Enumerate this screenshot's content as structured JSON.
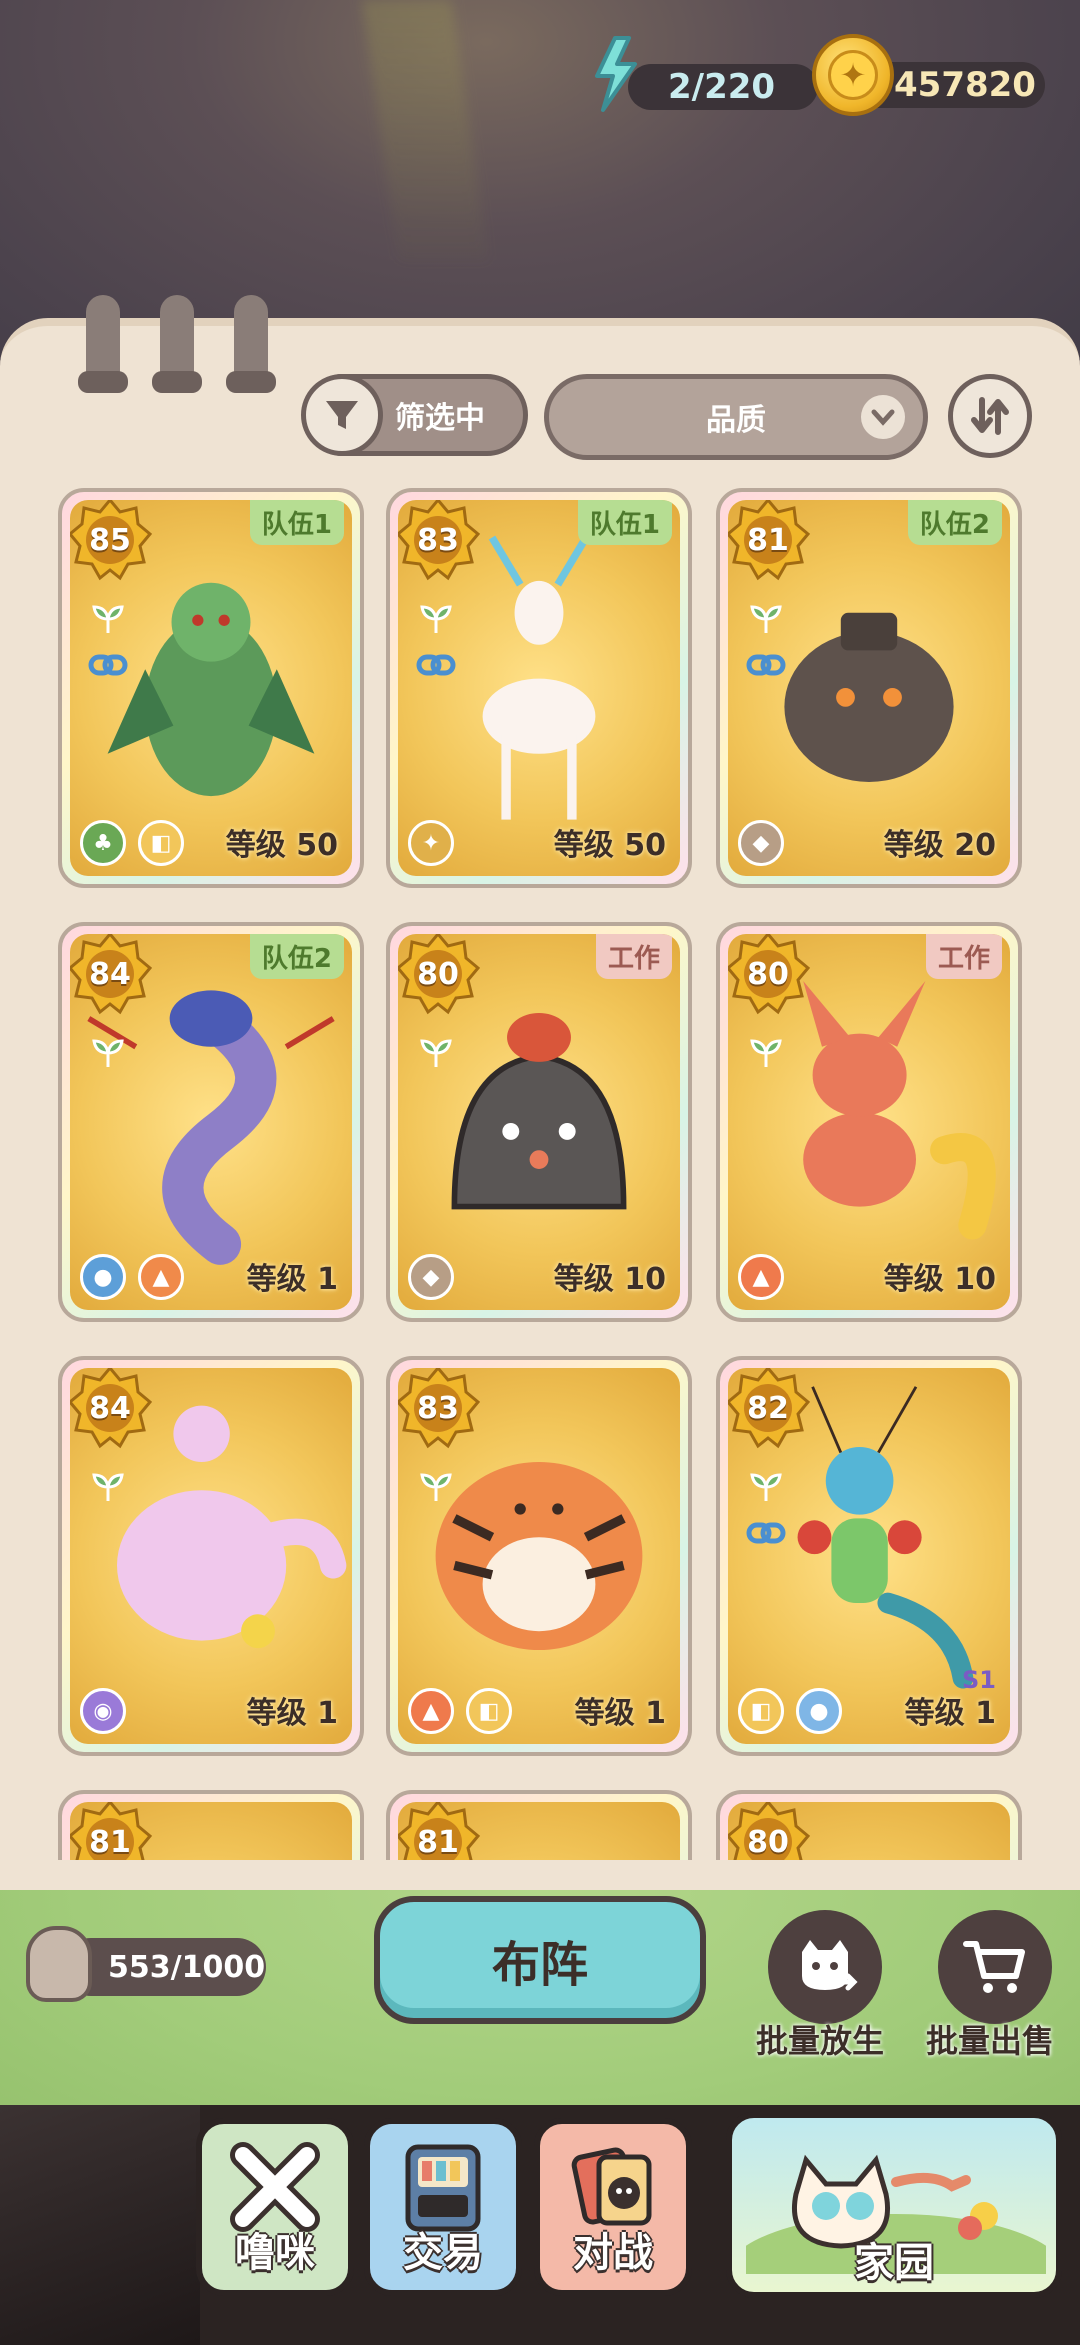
{
  "status": {
    "energy": "2/220",
    "coins": "457820"
  },
  "toolbar": {
    "filter_label": "筛选中",
    "quality_label": "品质"
  },
  "cards": [
    {
      "power": "85",
      "tag": "队伍1",
      "tag_type": "team",
      "level": "等级 50",
      "creature": "grass-warrior"
    },
    {
      "power": "83",
      "tag": "队伍1",
      "tag_type": "team",
      "level": "等级 50",
      "creature": "white-deer"
    },
    {
      "power": "81",
      "tag": "队伍2",
      "tag_type": "team",
      "level": "等级 20",
      "creature": "rock-golem"
    },
    {
      "power": "84",
      "tag": "队伍2",
      "tag_type": "team",
      "level": "等级 1",
      "creature": "water-dragon"
    },
    {
      "power": "80",
      "tag": "工作",
      "tag_type": "work",
      "level": "等级 10",
      "creature": "rock-blob"
    },
    {
      "power": "80",
      "tag": "工作",
      "tag_type": "work",
      "level": "等级 10",
      "creature": "fire-fox"
    },
    {
      "power": "84",
      "tag": "",
      "tag_type": "",
      "level": "等级 1",
      "creature": "pink-bunny"
    },
    {
      "power": "83",
      "tag": "",
      "tag_type": "",
      "level": "等级 1",
      "creature": "tiger"
    },
    {
      "power": "82",
      "tag": "",
      "tag_type": "",
      "level": "等级 1",
      "badge": "S1",
      "creature": "bug-boxer"
    },
    {
      "power": "81",
      "tag": "",
      "tag_type": "",
      "level": "",
      "creature": ""
    },
    {
      "power": "81",
      "tag": "",
      "tag_type": "",
      "level": "",
      "creature": ""
    },
    {
      "power": "80",
      "tag": "",
      "tag_type": "",
      "level": "",
      "creature": ""
    }
  ],
  "bottom": {
    "cat_count": "553/1000",
    "deploy_label": "布阵",
    "batch_release": "批量放生",
    "batch_sell": "批量出售"
  },
  "nav": {
    "close": "噜咪",
    "trade": "交易",
    "battle": "对战",
    "home": "家园"
  },
  "colors": {
    "panel": "#efe3d3",
    "accent": "#7dd4d8",
    "team_tag": "#b6dd92",
    "work_tag": "#f1c9c2"
  }
}
